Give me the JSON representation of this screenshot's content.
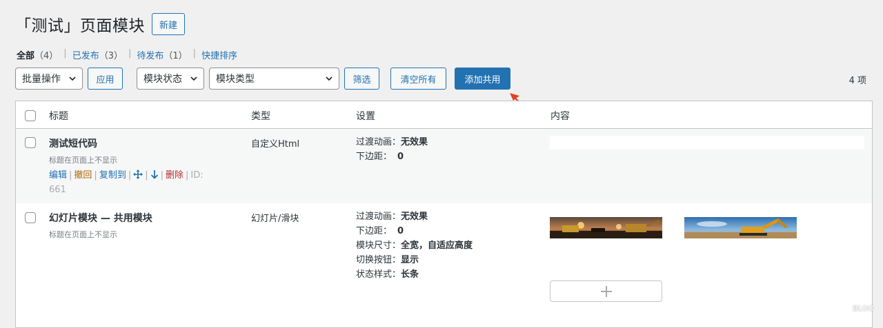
{
  "header": {
    "title": "「测试」页面模块",
    "new_label": "新建"
  },
  "views": [
    {
      "label": "全部",
      "count": "（4）"
    },
    {
      "label": "已发布",
      "count": "（3）"
    },
    {
      "label": "待发布",
      "count": "（1）"
    },
    {
      "label": "快捷排序"
    }
  ],
  "toolbar": {
    "bulk": "批量操作",
    "apply": "应用",
    "status": "模块状态",
    "type": "模块类型",
    "filter": "筛选",
    "clear": "清空所有",
    "add_shared": "添加共用",
    "count": "4 项"
  },
  "table": {
    "headers": {
      "title": "标题",
      "type": "类型",
      "settings": "设置",
      "content": "内容"
    },
    "rows": [
      {
        "title": "测试短代码",
        "note": "标题在页面上不显示",
        "type": "自定义Html",
        "settings": [
          {
            "k": "过渡动画：",
            "v": "无效果"
          },
          {
            "k": "下边距：",
            "v": "0"
          }
        ],
        "actions": {
          "edit": "编辑",
          "revoke": "撤回",
          "copy": "复制到",
          "delete": "删除",
          "id_label": "ID:",
          "id": "661"
        }
      },
      {
        "title": "幻灯片模块 — 共用模块",
        "note": "标题在页面上不显示",
        "type": "幻灯片/滑块",
        "settings": [
          {
            "k": "过渡动画：",
            "v": "无效果"
          },
          {
            "k": "下边距：",
            "v": "0"
          },
          {
            "k": "模块尺寸：",
            "v": "全宽，自适应高度"
          },
          {
            "k": "切换按钮：",
            "v": "显示"
          },
          {
            "k": "状态样式：",
            "v": "长条"
          }
        ]
      }
    ]
  },
  "watermark": "BLOG",
  "colors": {
    "accent": "#2271b1",
    "annotation_arrow": "#e0442a"
  }
}
